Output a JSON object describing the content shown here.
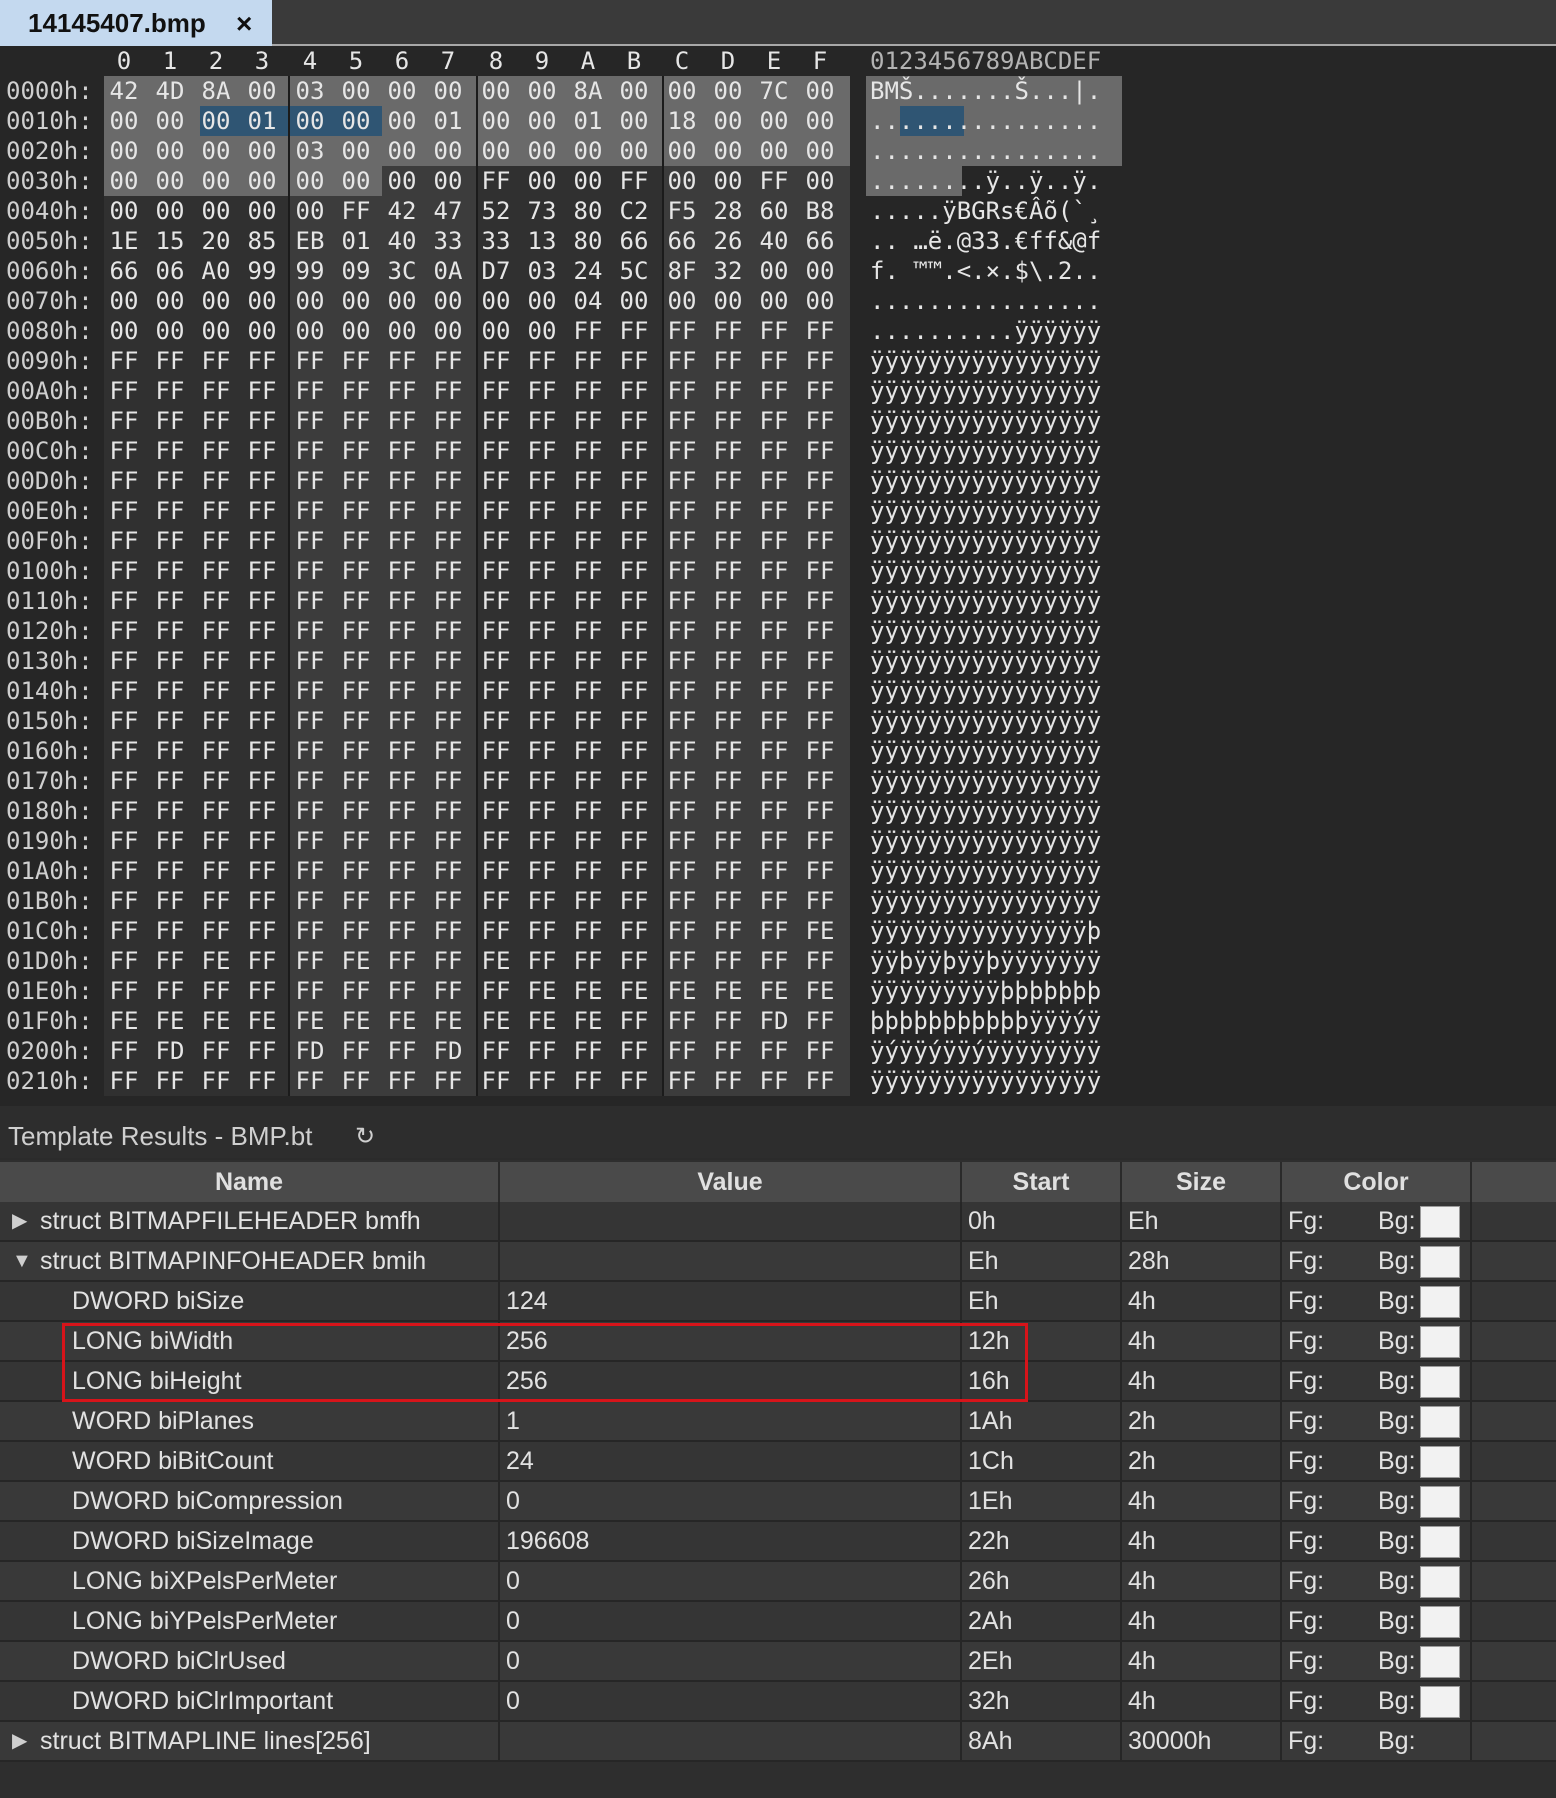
{
  "tab": {
    "title": "14145407.bmp",
    "close_glyph": "×"
  },
  "hex": {
    "column_headers": [
      "0",
      "1",
      "2",
      "3",
      "4",
      "5",
      "6",
      "7",
      "8",
      "9",
      "A",
      "B",
      "C",
      "D",
      "E",
      "F"
    ],
    "ascii_header": "0123456789ABCDEF",
    "rows": [
      {
        "addr": "0000h:",
        "bytes": [
          "42",
          "4D",
          "8A",
          "00",
          "03",
          "00",
          "00",
          "00",
          "00",
          "00",
          "8A",
          "00",
          "00",
          "00",
          "7C",
          "00"
        ],
        "ascii": "BMŠ.......Š...|."
      },
      {
        "addr": "0010h:",
        "bytes": [
          "00",
          "00",
          "00",
          "01",
          "00",
          "00",
          "00",
          "01",
          "00",
          "00",
          "01",
          "00",
          "18",
          "00",
          "00",
          "00"
        ],
        "ascii": "................"
      },
      {
        "addr": "0020h:",
        "bytes": [
          "00",
          "00",
          "00",
          "00",
          "03",
          "00",
          "00",
          "00",
          "00",
          "00",
          "00",
          "00",
          "00",
          "00",
          "00",
          "00"
        ],
        "ascii": "................"
      },
      {
        "addr": "0030h:",
        "bytes": [
          "00",
          "00",
          "00",
          "00",
          "00",
          "00",
          "00",
          "00",
          "FF",
          "00",
          "00",
          "FF",
          "00",
          "00",
          "FF",
          "00"
        ],
        "ascii": "........ÿ..ÿ..ÿ."
      },
      {
        "addr": "0040h:",
        "bytes": [
          "00",
          "00",
          "00",
          "00",
          "00",
          "FF",
          "42",
          "47",
          "52",
          "73",
          "80",
          "C2",
          "F5",
          "28",
          "60",
          "B8"
        ],
        "ascii": ".....ÿBGRs€Âõ(`¸"
      },
      {
        "addr": "0050h:",
        "bytes": [
          "1E",
          "15",
          "20",
          "85",
          "EB",
          "01",
          "40",
          "33",
          "33",
          "13",
          "80",
          "66",
          "66",
          "26",
          "40",
          "66"
        ],
        "ascii": ".. …ë.@33.€ff&@f"
      },
      {
        "addr": "0060h:",
        "bytes": [
          "66",
          "06",
          "A0",
          "99",
          "99",
          "09",
          "3C",
          "0A",
          "D7",
          "03",
          "24",
          "5C",
          "8F",
          "32",
          "00",
          "00"
        ],
        "ascii": "f. ™™.<.×.$\\.2.."
      },
      {
        "addr": "0070h:",
        "bytes": [
          "00",
          "00",
          "00",
          "00",
          "00",
          "00",
          "00",
          "00",
          "00",
          "00",
          "04",
          "00",
          "00",
          "00",
          "00",
          "00"
        ],
        "ascii": "................"
      },
      {
        "addr": "0080h:",
        "bytes": [
          "00",
          "00",
          "00",
          "00",
          "00",
          "00",
          "00",
          "00",
          "00",
          "00",
          "FF",
          "FF",
          "FF",
          "FF",
          "FF",
          "FF"
        ],
        "ascii": "..........ÿÿÿÿÿÿ"
      },
      {
        "addr": "0090h:",
        "bytes": [
          "FF",
          "FF",
          "FF",
          "FF",
          "FF",
          "FF",
          "FF",
          "FF",
          "FF",
          "FF",
          "FF",
          "FF",
          "FF",
          "FF",
          "FF",
          "FF"
        ],
        "ascii": "ÿÿÿÿÿÿÿÿÿÿÿÿÿÿÿÿ"
      },
      {
        "addr": "00A0h:",
        "bytes": [
          "FF",
          "FF",
          "FF",
          "FF",
          "FF",
          "FF",
          "FF",
          "FF",
          "FF",
          "FF",
          "FF",
          "FF",
          "FF",
          "FF",
          "FF",
          "FF"
        ],
        "ascii": "ÿÿÿÿÿÿÿÿÿÿÿÿÿÿÿÿ"
      },
      {
        "addr": "00B0h:",
        "bytes": [
          "FF",
          "FF",
          "FF",
          "FF",
          "FF",
          "FF",
          "FF",
          "FF",
          "FF",
          "FF",
          "FF",
          "FF",
          "FF",
          "FF",
          "FF",
          "FF"
        ],
        "ascii": "ÿÿÿÿÿÿÿÿÿÿÿÿÿÿÿÿ"
      },
      {
        "addr": "00C0h:",
        "bytes": [
          "FF",
          "FF",
          "FF",
          "FF",
          "FF",
          "FF",
          "FF",
          "FF",
          "FF",
          "FF",
          "FF",
          "FF",
          "FF",
          "FF",
          "FF",
          "FF"
        ],
        "ascii": "ÿÿÿÿÿÿÿÿÿÿÿÿÿÿÿÿ"
      },
      {
        "addr": "00D0h:",
        "bytes": [
          "FF",
          "FF",
          "FF",
          "FF",
          "FF",
          "FF",
          "FF",
          "FF",
          "FF",
          "FF",
          "FF",
          "FF",
          "FF",
          "FF",
          "FF",
          "FF"
        ],
        "ascii": "ÿÿÿÿÿÿÿÿÿÿÿÿÿÿÿÿ"
      },
      {
        "addr": "00E0h:",
        "bytes": [
          "FF",
          "FF",
          "FF",
          "FF",
          "FF",
          "FF",
          "FF",
          "FF",
          "FF",
          "FF",
          "FF",
          "FF",
          "FF",
          "FF",
          "FF",
          "FF"
        ],
        "ascii": "ÿÿÿÿÿÿÿÿÿÿÿÿÿÿÿÿ"
      },
      {
        "addr": "00F0h:",
        "bytes": [
          "FF",
          "FF",
          "FF",
          "FF",
          "FF",
          "FF",
          "FF",
          "FF",
          "FF",
          "FF",
          "FF",
          "FF",
          "FF",
          "FF",
          "FF",
          "FF"
        ],
        "ascii": "ÿÿÿÿÿÿÿÿÿÿÿÿÿÿÿÿ"
      },
      {
        "addr": "0100h:",
        "bytes": [
          "FF",
          "FF",
          "FF",
          "FF",
          "FF",
          "FF",
          "FF",
          "FF",
          "FF",
          "FF",
          "FF",
          "FF",
          "FF",
          "FF",
          "FF",
          "FF"
        ],
        "ascii": "ÿÿÿÿÿÿÿÿÿÿÿÿÿÿÿÿ"
      },
      {
        "addr": "0110h:",
        "bytes": [
          "FF",
          "FF",
          "FF",
          "FF",
          "FF",
          "FF",
          "FF",
          "FF",
          "FF",
          "FF",
          "FF",
          "FF",
          "FF",
          "FF",
          "FF",
          "FF"
        ],
        "ascii": "ÿÿÿÿÿÿÿÿÿÿÿÿÿÿÿÿ"
      },
      {
        "addr": "0120h:",
        "bytes": [
          "FF",
          "FF",
          "FF",
          "FF",
          "FF",
          "FF",
          "FF",
          "FF",
          "FF",
          "FF",
          "FF",
          "FF",
          "FF",
          "FF",
          "FF",
          "FF"
        ],
        "ascii": "ÿÿÿÿÿÿÿÿÿÿÿÿÿÿÿÿ"
      },
      {
        "addr": "0130h:",
        "bytes": [
          "FF",
          "FF",
          "FF",
          "FF",
          "FF",
          "FF",
          "FF",
          "FF",
          "FF",
          "FF",
          "FF",
          "FF",
          "FF",
          "FF",
          "FF",
          "FF"
        ],
        "ascii": "ÿÿÿÿÿÿÿÿÿÿÿÿÿÿÿÿ"
      },
      {
        "addr": "0140h:",
        "bytes": [
          "FF",
          "FF",
          "FF",
          "FF",
          "FF",
          "FF",
          "FF",
          "FF",
          "FF",
          "FF",
          "FF",
          "FF",
          "FF",
          "FF",
          "FF",
          "FF"
        ],
        "ascii": "ÿÿÿÿÿÿÿÿÿÿÿÿÿÿÿÿ"
      },
      {
        "addr": "0150h:",
        "bytes": [
          "FF",
          "FF",
          "FF",
          "FF",
          "FF",
          "FF",
          "FF",
          "FF",
          "FF",
          "FF",
          "FF",
          "FF",
          "FF",
          "FF",
          "FF",
          "FF"
        ],
        "ascii": "ÿÿÿÿÿÿÿÿÿÿÿÿÿÿÿÿ"
      },
      {
        "addr": "0160h:",
        "bytes": [
          "FF",
          "FF",
          "FF",
          "FF",
          "FF",
          "FF",
          "FF",
          "FF",
          "FF",
          "FF",
          "FF",
          "FF",
          "FF",
          "FF",
          "FF",
          "FF"
        ],
        "ascii": "ÿÿÿÿÿÿÿÿÿÿÿÿÿÿÿÿ"
      },
      {
        "addr": "0170h:",
        "bytes": [
          "FF",
          "FF",
          "FF",
          "FF",
          "FF",
          "FF",
          "FF",
          "FF",
          "FF",
          "FF",
          "FF",
          "FF",
          "FF",
          "FF",
          "FF",
          "FF"
        ],
        "ascii": "ÿÿÿÿÿÿÿÿÿÿÿÿÿÿÿÿ"
      },
      {
        "addr": "0180h:",
        "bytes": [
          "FF",
          "FF",
          "FF",
          "FF",
          "FF",
          "FF",
          "FF",
          "FF",
          "FF",
          "FF",
          "FF",
          "FF",
          "FF",
          "FF",
          "FF",
          "FF"
        ],
        "ascii": "ÿÿÿÿÿÿÿÿÿÿÿÿÿÿÿÿ"
      },
      {
        "addr": "0190h:",
        "bytes": [
          "FF",
          "FF",
          "FF",
          "FF",
          "FF",
          "FF",
          "FF",
          "FF",
          "FF",
          "FF",
          "FF",
          "FF",
          "FF",
          "FF",
          "FF",
          "FF"
        ],
        "ascii": "ÿÿÿÿÿÿÿÿÿÿÿÿÿÿÿÿ"
      },
      {
        "addr": "01A0h:",
        "bytes": [
          "FF",
          "FF",
          "FF",
          "FF",
          "FF",
          "FF",
          "FF",
          "FF",
          "FF",
          "FF",
          "FF",
          "FF",
          "FF",
          "FF",
          "FF",
          "FF"
        ],
        "ascii": "ÿÿÿÿÿÿÿÿÿÿÿÿÿÿÿÿ"
      },
      {
        "addr": "01B0h:",
        "bytes": [
          "FF",
          "FF",
          "FF",
          "FF",
          "FF",
          "FF",
          "FF",
          "FF",
          "FF",
          "FF",
          "FF",
          "FF",
          "FF",
          "FF",
          "FF",
          "FF"
        ],
        "ascii": "ÿÿÿÿÿÿÿÿÿÿÿÿÿÿÿÿ"
      },
      {
        "addr": "01C0h:",
        "bytes": [
          "FF",
          "FF",
          "FF",
          "FF",
          "FF",
          "FF",
          "FF",
          "FF",
          "FF",
          "FF",
          "FF",
          "FF",
          "FF",
          "FF",
          "FF",
          "FE"
        ],
        "ascii": "ÿÿÿÿÿÿÿÿÿÿÿÿÿÿÿþ"
      },
      {
        "addr": "01D0h:",
        "bytes": [
          "FF",
          "FF",
          "FE",
          "FF",
          "FF",
          "FE",
          "FF",
          "FF",
          "FE",
          "FF",
          "FF",
          "FF",
          "FF",
          "FF",
          "FF",
          "FF"
        ],
        "ascii": "ÿÿþÿÿþÿÿþÿÿÿÿÿÿÿ"
      },
      {
        "addr": "01E0h:",
        "bytes": [
          "FF",
          "FF",
          "FF",
          "FF",
          "FF",
          "FF",
          "FF",
          "FF",
          "FF",
          "FE",
          "FE",
          "FE",
          "FE",
          "FE",
          "FE",
          "FE"
        ],
        "ascii": "ÿÿÿÿÿÿÿÿÿþþþþþþþ"
      },
      {
        "addr": "01F0h:",
        "bytes": [
          "FE",
          "FE",
          "FE",
          "FE",
          "FE",
          "FE",
          "FE",
          "FE",
          "FE",
          "FE",
          "FE",
          "FF",
          "FF",
          "FF",
          "FD",
          "FF"
        ],
        "ascii": "þþþþþþþþþþþÿÿÿýÿ"
      },
      {
        "addr": "0200h:",
        "bytes": [
          "FF",
          "FD",
          "FF",
          "FF",
          "FD",
          "FF",
          "FF",
          "FD",
          "FF",
          "FF",
          "FF",
          "FF",
          "FF",
          "FF",
          "FF",
          "FF"
        ],
        "ascii": "ÿýÿÿýÿÿýÿÿÿÿÿÿÿÿ"
      },
      {
        "addr": "0210h:",
        "bytes": [
          "FF",
          "FF",
          "FF",
          "FF",
          "FF",
          "FF",
          "FF",
          "FF",
          "FF",
          "FF",
          "FF",
          "FF",
          "FF",
          "FF",
          "FF",
          "FF"
        ],
        "ascii": "ÿÿÿÿÿÿÿÿÿÿÿÿÿÿÿÿ"
      }
    ]
  },
  "results": {
    "title": "Template Results - BMP.bt",
    "refresh_glyph": "↻",
    "columns": [
      "Name",
      "Value",
      "Start",
      "Size",
      "Color"
    ],
    "fg_label": "Fg:",
    "bg_label": "Bg:",
    "rows": [
      {
        "name": "struct BITMAPFILEHEADER bmfh",
        "value": "",
        "start": "0h",
        "size": "Eh",
        "indent": 0,
        "twisty": "▶",
        "swatch": true
      },
      {
        "name": "struct BITMAPINFOHEADER bmih",
        "value": "",
        "start": "Eh",
        "size": "28h",
        "indent": 0,
        "twisty": "▼",
        "swatch": true
      },
      {
        "name": "DWORD biSize",
        "value": "124",
        "start": "Eh",
        "size": "4h",
        "indent": 1,
        "twisty": "",
        "swatch": true
      },
      {
        "name": "LONG biWidth",
        "value": "256",
        "start": "12h",
        "size": "4h",
        "indent": 1,
        "twisty": "",
        "swatch": true
      },
      {
        "name": "LONG biHeight",
        "value": "256",
        "start": "16h",
        "size": "4h",
        "indent": 1,
        "twisty": "",
        "swatch": true
      },
      {
        "name": "WORD biPlanes",
        "value": "1",
        "start": "1Ah",
        "size": "2h",
        "indent": 1,
        "twisty": "",
        "swatch": true
      },
      {
        "name": "WORD biBitCount",
        "value": "24",
        "start": "1Ch",
        "size": "2h",
        "indent": 1,
        "twisty": "",
        "swatch": true
      },
      {
        "name": "DWORD biCompression",
        "value": "0",
        "start": "1Eh",
        "size": "4h",
        "indent": 1,
        "twisty": "",
        "swatch": true
      },
      {
        "name": "DWORD biSizeImage",
        "value": "196608",
        "start": "22h",
        "size": "4h",
        "indent": 1,
        "twisty": "",
        "swatch": true
      },
      {
        "name": "LONG biXPelsPerMeter",
        "value": "0",
        "start": "26h",
        "size": "4h",
        "indent": 1,
        "twisty": "",
        "swatch": true
      },
      {
        "name": "LONG biYPelsPerMeter",
        "value": "0",
        "start": "2Ah",
        "size": "4h",
        "indent": 1,
        "twisty": "",
        "swatch": true
      },
      {
        "name": "DWORD biClrUsed",
        "value": "0",
        "start": "2Eh",
        "size": "4h",
        "indent": 1,
        "twisty": "",
        "swatch": true
      },
      {
        "name": "DWORD biClrImportant",
        "value": "0",
        "start": "32h",
        "size": "4h",
        "indent": 1,
        "twisty": "",
        "swatch": true
      },
      {
        "name": "struct BITMAPLINE lines[256]",
        "value": "",
        "start": "8Ah",
        "size": "30000h",
        "indent": 0,
        "twisty": "▶",
        "swatch": false
      }
    ]
  },
  "colors": {
    "tab_background": "#c4d9ef",
    "header_bytes_bg": "#6a6a6a",
    "selection_bg": "#2f5573",
    "highlight_box": "#d7141a",
    "swatch_bg": "#f2f2f2"
  }
}
